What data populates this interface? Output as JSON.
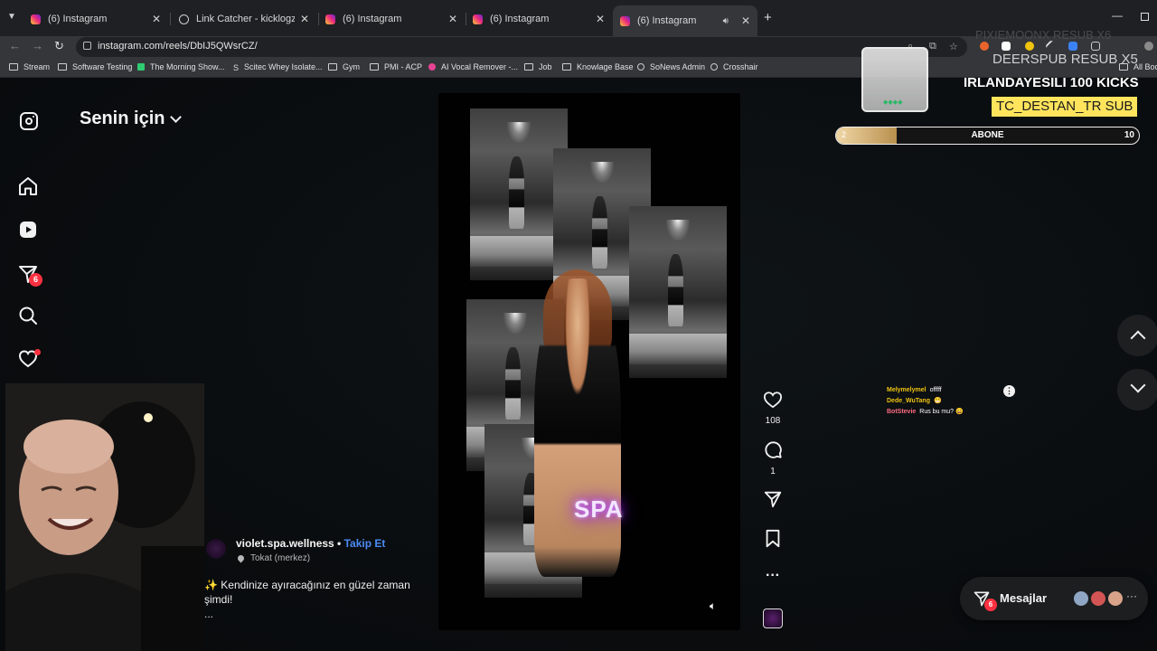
{
  "browser": {
    "tabs": [
      {
        "title": "(6) Instagram",
        "icon": "instagram-icon"
      },
      {
        "title": "Link Catcher - kicklogz Tools",
        "icon": "globe-icon"
      },
      {
        "title": "(6) Instagram",
        "icon": "instagram-icon"
      },
      {
        "title": "(6) Instagram",
        "icon": "instagram-icon"
      },
      {
        "title": "(6) Instagram",
        "icon": "instagram-icon",
        "active": true
      }
    ],
    "url": "instagram.com/reels/DbIJ5QWsrCZ/",
    "bookmarks": [
      "Stream",
      "Software Testing",
      "The Morning Show...",
      "Scitec Whey Isolate...",
      "Gym",
      "PMI - ACP",
      "AI Vocal Remover -...",
      "Job",
      "Knowlage Base",
      "SoNews Admin",
      "Crosshair",
      "All Book"
    ]
  },
  "instagram": {
    "feed_title": "Senin için",
    "nav_badge": "6",
    "reel": {
      "username": "violet.spa.wellness",
      "separator": " • ",
      "follow_label": "Takip Et",
      "location": "Tokat (merkez)",
      "caption": "✨ Kendinize ayıracağınız en güzel zaman şimdi!",
      "caption_more": "...",
      "overlay_text": "SPA",
      "likes": "108",
      "comments": "1"
    },
    "messages": {
      "label": "Mesajlar",
      "badge": "6"
    }
  },
  "stream_overlay": {
    "faded_text": "PIXIEMOONX RESUB X6",
    "deerspub_text": "DEERSPUB  RESUB X5",
    "irlanda_text": "IRLANDAYESILI  100 KICKS",
    "tc_text": "TC_DESTAN_TR  SUB",
    "sub_goal": {
      "label": "ABONE",
      "start": "2",
      "end": "10",
      "progress_fraction": 0.2
    },
    "gems_text": "◆◆◆◆",
    "chat": [
      {
        "user": "Melymelymel",
        "message": "offfff",
        "color": "#f1c40f"
      },
      {
        "user": "Dede_WuTang",
        "message": "😁",
        "color": "#f1c40f"
      },
      {
        "user": "BotStevie",
        "message": "Rus bu mu? 😄",
        "color": "#ff6b81"
      }
    ]
  },
  "colors": {
    "accent": "#4c8bf5",
    "badge": "#ff3040",
    "highlight": "#ffe45c"
  }
}
